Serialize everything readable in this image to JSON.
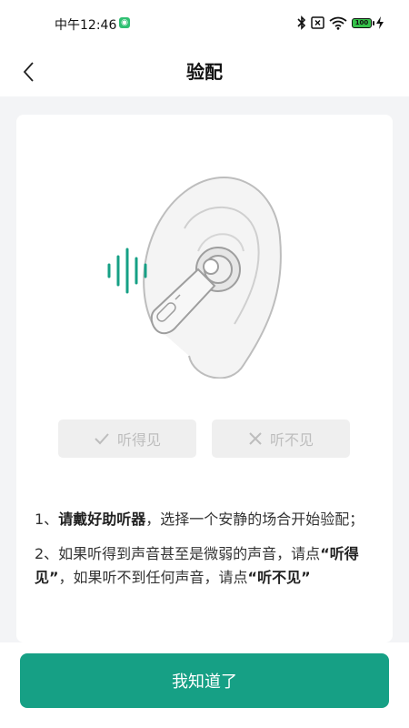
{
  "status_bar": {
    "time": "中午12:46",
    "app_icon_glyph": "◉",
    "battery_level": "100",
    "icons": [
      "bluetooth-icon",
      "sim-off-icon",
      "wifi-icon",
      "battery-icon",
      "charging-icon"
    ]
  },
  "header": {
    "title": "验配",
    "back_icon": "chevron-left-icon"
  },
  "illustration": {
    "name": "ear-with-hearing-aid-illustration",
    "accent_color": "#16a085"
  },
  "choices": {
    "hear_label": "听得见",
    "not_hear_label": "听不见",
    "hear_icon": "check-icon",
    "not_hear_icon": "x-icon"
  },
  "instructions": {
    "item1_prefix": "1、",
    "item1_bold": "请戴好助听器",
    "item1_rest": "，选择一个安静的场合开始验配；",
    "item2_prefix": "2、如果听得到声音甚至是微弱的声音，请点",
    "item2_bold1": "“听得见”",
    "item2_mid": "，如果听不到任何声音，请点",
    "item2_bold2": "“听不见”"
  },
  "footer": {
    "confirm_label": "我知道了"
  },
  "colors": {
    "primary": "#16a085",
    "background": "#f3f4f6",
    "disabled_button": "#efefef",
    "disabled_text": "#bdbdbd"
  }
}
